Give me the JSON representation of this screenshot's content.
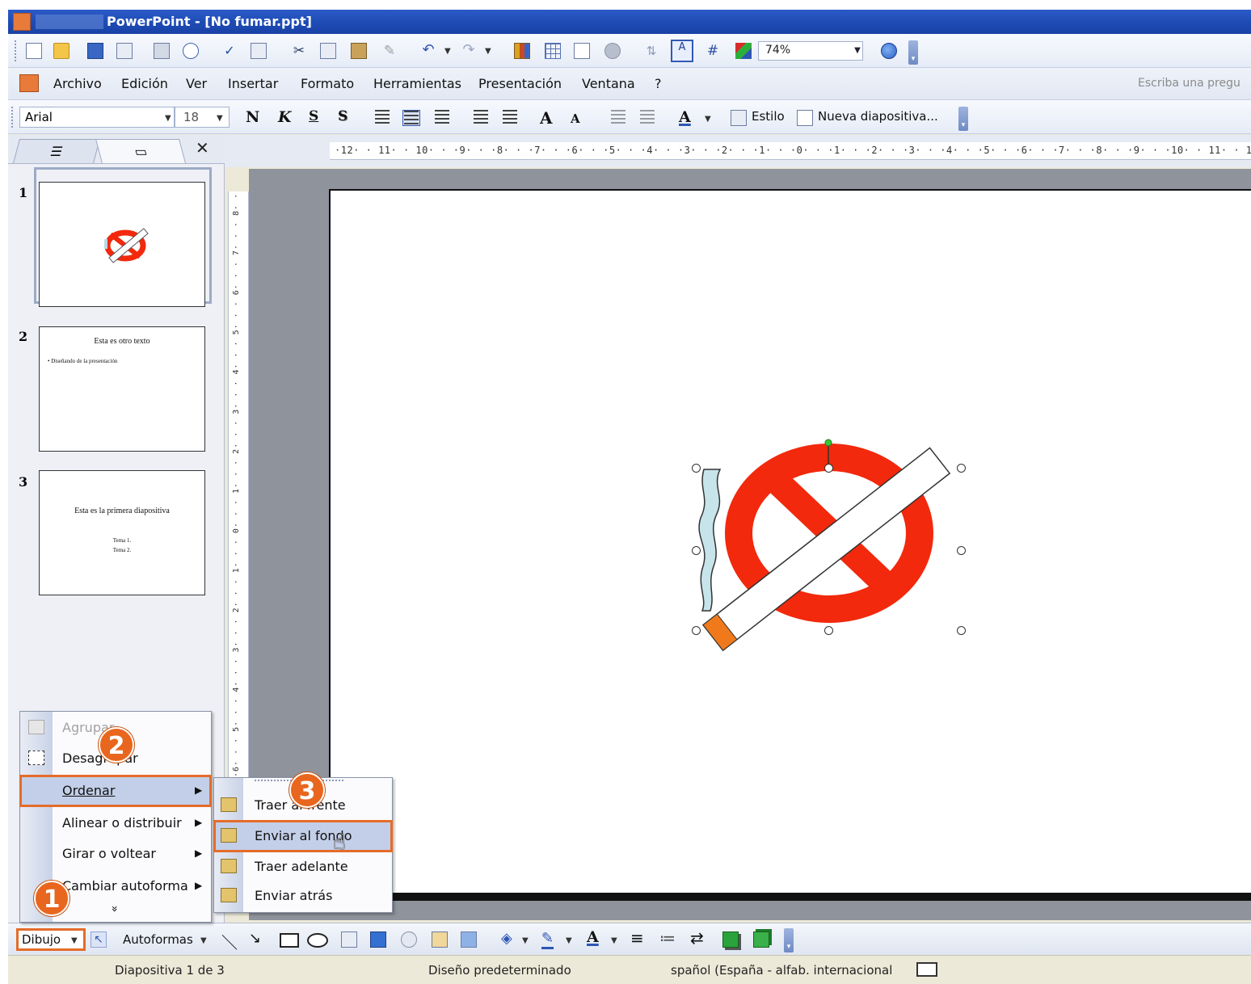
{
  "window": {
    "title": "PowerPoint - [No fumar.ppt]"
  },
  "standard_toolbar": {
    "zoom": "74%"
  },
  "menubar": {
    "items": [
      "Archivo",
      "Edición",
      "Ver",
      "Insertar",
      "Formato",
      "Herramientas",
      "Presentación",
      "Ventana",
      "?"
    ],
    "ask_placeholder": "Escriba una pregu"
  },
  "format_toolbar": {
    "font": "Arial",
    "size": "18",
    "bold": "N",
    "italic": "K",
    "underline": "S",
    "shadow": "S",
    "style_label": "Estilo",
    "new_slide_label": "Nueva diapositiva..."
  },
  "hruler_text": "·12· · 11· · 10· · ·9· · ·8· · ·7· · ·6· · ·5· · ·4· · ·3· · ·2· · ·1· · ·0· · ·1· · ·2· · ·3· · ·4· · ·5· · ·6· · ·7· · ·8· · ·9· · ·10· · 11· · 12·",
  "vruler_text": "·6· · · 5· · · 4· · · 3· · · 2· · · 1· · · 0· · · 1· · · 2· · · 3· · · 4· · · 5· · · 6· · · 7· · · 8· · · 9·",
  "thumbnails": [
    {
      "num": "1"
    },
    {
      "num": "2",
      "title": "Esta es otro texto",
      "bullet": "• Diseñando de la presentación"
    },
    {
      "num": "3",
      "title": "Esta es la primera diapositiva",
      "line1": "Tema 1.",
      "line2": "Tema 2."
    }
  ],
  "context_menu": {
    "items": [
      "Agrupar",
      "Desagrupar",
      "Ordenar",
      "Alinear o distribuir",
      "Girar o voltear",
      "Cambiar autoforma"
    ],
    "expand": "»"
  },
  "submenu": {
    "items": [
      "Traer al frente",
      "Enviar al fondo",
      "Traer adelante",
      "Enviar atrás"
    ]
  },
  "drawing_toolbar": {
    "dibujo": "Dibujo",
    "autoformas": "Autoformas"
  },
  "status": {
    "slide": "Diapositiva 1 de 3",
    "design": "Diseño predeterminado",
    "language": "spañol (España - alfab. internacional"
  },
  "badges": [
    "1",
    "2",
    "3"
  ],
  "colors": {
    "accent_orange": "#e8661d",
    "title_blue": "#1f4eb8",
    "nosmoke_red": "#f2290c",
    "cigarette_tip": "#f07a1b",
    "smoke": "#c6e4ea"
  }
}
